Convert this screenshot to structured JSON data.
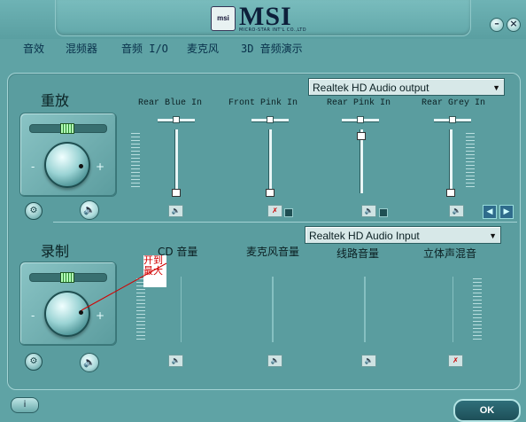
{
  "header": {
    "logo_text": "MSI",
    "logo_badge": "msi",
    "logo_subtitle": "MICRO-STAR INT'L CO.,LTD",
    "window_buttons": [
      "–",
      "×"
    ]
  },
  "menu": [
    {
      "label": "音效"
    },
    {
      "label": "混频器"
    },
    {
      "label": "音频 I/O"
    },
    {
      "label": "麦克风"
    },
    {
      "label": "3D 音频演示"
    }
  ],
  "playback": {
    "title": "重放",
    "device": "Realtek HD Audio output",
    "knob_minus": "-",
    "knob_plus": "+",
    "channels": [
      {
        "label": "Rear Blue In",
        "level": 0.0,
        "muted": false
      },
      {
        "label": "Front Pink In",
        "level": 0.0,
        "muted": true
      },
      {
        "label": "Rear Pink In",
        "level": 1.0,
        "muted": false
      },
      {
        "label": "Rear Grey In",
        "level": 0.0,
        "muted": false
      }
    ]
  },
  "recording": {
    "title": "录制",
    "device": "Realtek HD Audio Input",
    "knob_minus": "-",
    "knob_plus": "+",
    "annotation": "开到最大",
    "channels": [
      {
        "label": "CD 音量",
        "muted": false
      },
      {
        "label": "麦克风音量",
        "muted": false
      },
      {
        "label": "线路音量",
        "muted": false
      },
      {
        "label": "立体声混音",
        "muted": true
      }
    ]
  },
  "footer": {
    "info_icon": "i",
    "ok_label": "OK"
  },
  "colors": {
    "background": "#5fa3a5",
    "annotation_red": "#d20000",
    "balance_green": "#2d8b33"
  },
  "icons": [
    "wrench-icon",
    "speaker-icon",
    "mute-icon",
    "chevron-left-icon",
    "chevron-right-icon",
    "info-icon"
  ]
}
